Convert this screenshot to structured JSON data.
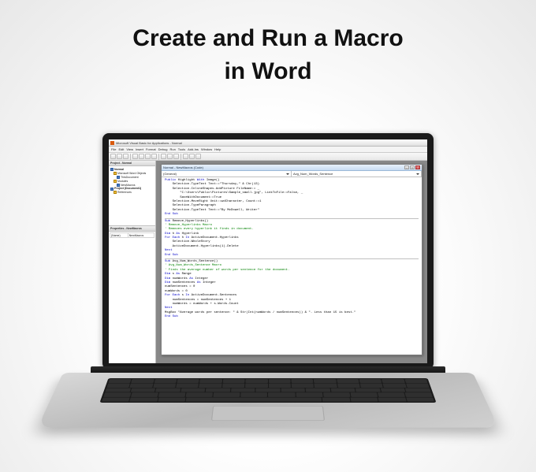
{
  "headline": {
    "line1": "Create and Run a Macro",
    "line2": "in Word"
  },
  "vba": {
    "title": "Microsoft Visual Basic for Applications - Normal",
    "menus": [
      "File",
      "Edit",
      "View",
      "Insert",
      "Format",
      "Debug",
      "Run",
      "Tools",
      "Add-Ins",
      "Window",
      "Help"
    ],
    "project_panel_title": "Project - Normal",
    "properties_panel_title": "Properties - NewMacros",
    "tree": {
      "root": "Normal",
      "folder1": "Microsoft Word Objects",
      "doc": "ThisDocument",
      "folder2": "Modules",
      "module": "NewMacros",
      "project2": "Project (Document1)",
      "refs": "References"
    },
    "properties": {
      "name_label": "(Name)",
      "name_value": "NewMacros"
    },
    "code_window_title": "Normal - NewMacros (Code)",
    "dropdown_left": "(General)",
    "dropdown_right": "Avg_Num_Words_Sentence",
    "code": {
      "l1_a": "Public",
      "l1_b": " Highlight",
      "l1_c": " With",
      "l1_d": " Image()",
      "l2": "    Selection.TypeText Text:=\"Thursday,\" & Chr(13)",
      "l3": "    Selection.InlineShapes.AddPicture FileName:= _",
      "l4": "        \"C:\\Users\\Public\\Pictures\\Sample_small.jpg\", LinkToFile:=False, _",
      "l5": "        SaveWithDocument:=True",
      "l6": "    Selection.MoveRight Unit:=wdCharacter, Count:=1",
      "l7": "    Selection.TypeParagraph",
      "l8": "    Selection.TypeText Text:=\"By McDowell, Writer\"",
      "l9_a": "End Sub",
      "l10": "Sub",
      "l10b": " Remove_Hyperlinks()",
      "c1": "' Remove_Hyperlinks Macro",
      "c2": "' Removes every hyperlink it finds in document.",
      "l11_a": "Dim",
      "l11_b": " h ",
      "l11_c": "As",
      "l11_d": " Hyperlink",
      "l12_a": "For Each",
      "l12_b": " h ",
      "l12_c": "In",
      "l12_d": " ActiveDocument.Hyperlinks",
      "l13": "    Selection.WholeStory",
      "l14": "    ActiveDocument.Hyperlinks(1).Delete",
      "l15_a": "Next",
      "l16_a": "End Sub",
      "l17_a": "Sub",
      "l17_b": " Avg_Num_Words_Sentence()",
      "c3": "' Avg_Num_Words_Sentence Macro",
      "c4": "' Finds the average number of words per sentence for the document.",
      "l18_a": "Dim",
      "l18_b": " s ",
      "l18_c": "As",
      "l18_d": " Range",
      "l19_a": "Dim",
      "l19_b": " numWords ",
      "l19_c": "As",
      "l19_d": " Integer",
      "l20_a": "Dim",
      "l20_b": " numSentences ",
      "l20_c": "As",
      "l20_d": " Integer",
      "l21": "numSentences = 0",
      "l22": "numWords = 0",
      "l23_a": "For Each",
      "l23_b": " s ",
      "l23_c": "In",
      "l23_d": " ActiveDocument.Sentences",
      "l24": "    numSentences = numSentences + 1",
      "l25": "    numWords = numWords + s.Words.Count",
      "l26_a": "Next",
      "l27": "MsgBox \"Average words per sentence: \" & Str(Int(numWords / numSentences)) & \". Less than 15 is best.\"",
      "l28_a": "End Sub"
    }
  }
}
